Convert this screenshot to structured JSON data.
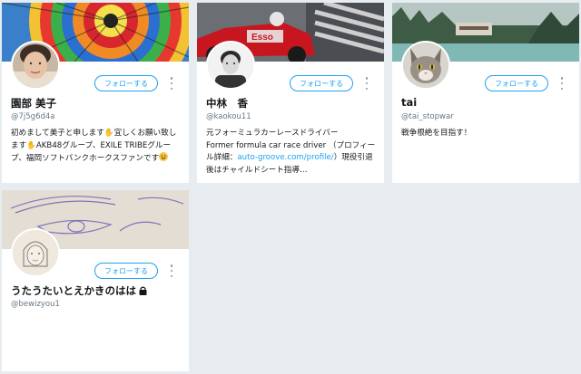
{
  "cards": [
    {
      "name": "園部 美子",
      "handle": "@7j5g6d4a",
      "follow_label": "フォローする",
      "bio_parts": [
        "初めまして美子と申します",
        "宜しくお願い致します",
        "AKB48グループ、EXILE TRIBEグループ、福岡ソフトバンクホークスファンです"
      ],
      "banner_icon": "hot-air-balloon-photo",
      "avatar_icon": "woman-portrait-photo"
    },
    {
      "name": "中林　香",
      "handle": "@kaokou11",
      "follow_label": "フォローする",
      "bio_line1": "元フォーミュラカーレースドライバー",
      "bio_line2": "Former formula car race driver （プロフィール詳細：",
      "bio_link": "auto-groove.com/profile/",
      "bio_line3": "）現役引退後はチャイルドシート指導…",
      "banner_icon": "formula-car-photo",
      "avatar_icon": "driver-portrait-photo"
    },
    {
      "name": "tai",
      "handle": "@tai_stopwar",
      "follow_label": "フォローする",
      "bio": "戦争根絶を目指す！",
      "banner_icon": "lake-forest-photo",
      "avatar_icon": "cat-photo"
    },
    {
      "name": "うたうたいとえかきのはは",
      "handle": "@bewizyou1",
      "follow_label": "フォローする",
      "banner_icon": "eye-sketch-drawing",
      "avatar_icon": "sketch-portrait-drawing"
    }
  ],
  "colors": {
    "accent": "#1da1f2",
    "background": "#e6ecf0",
    "muted": "#657786"
  }
}
